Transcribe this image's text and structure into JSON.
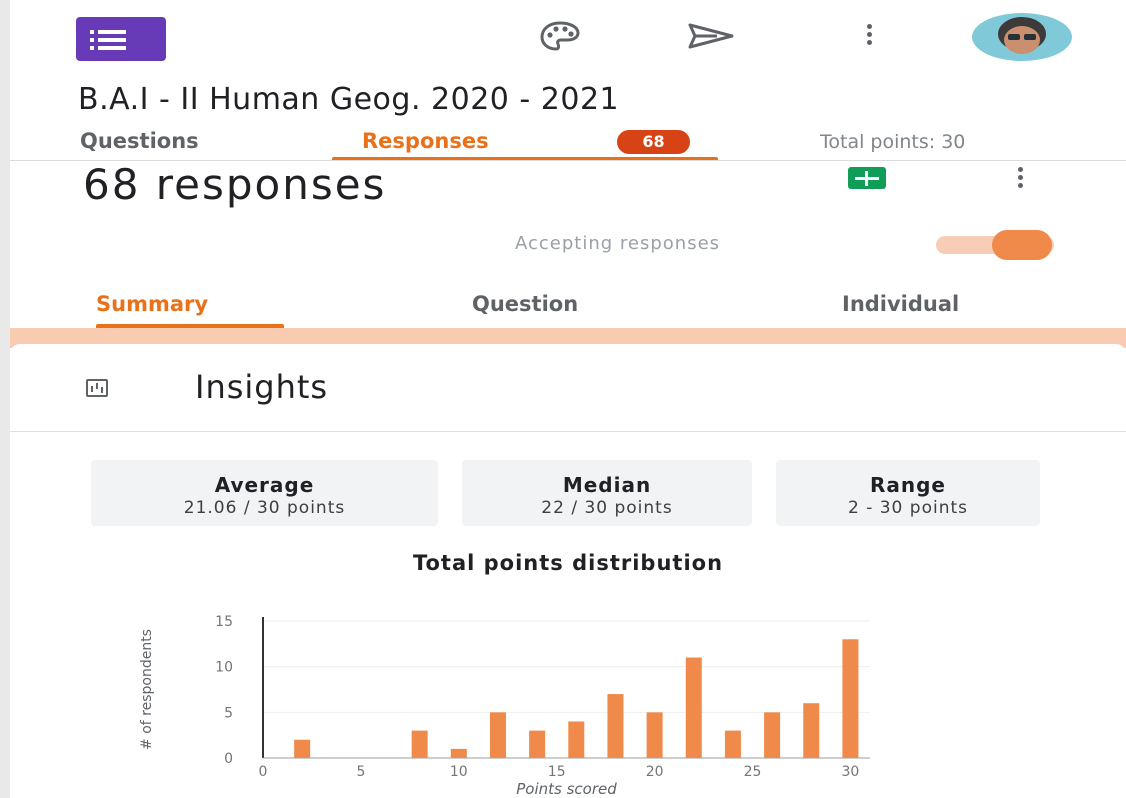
{
  "app": {
    "form_title": "B.A.I - II Human Geog. 2020 - 2021",
    "colors": {
      "accent": "#e8711a",
      "badge": "#d84315",
      "forms_purple": "#673ab7",
      "sheets_green": "#0f9d58"
    }
  },
  "topbar": {
    "icons": [
      "forms-app-icon",
      "palette-icon",
      "send-icon",
      "more-vert-icon",
      "avatar"
    ]
  },
  "tabs": {
    "questions_label": "Questions",
    "responses_label": "Responses",
    "responses_badge": "68",
    "total_points": "Total points: 30"
  },
  "responses_header": {
    "count_text": "68 responses",
    "accepting_label": "Accepting responses",
    "accepting_on": true
  },
  "subtabs": {
    "summary": "Summary",
    "question": "Question",
    "individual": "Individual"
  },
  "insights": {
    "title": "Insights",
    "average_label": "Average",
    "average_value": "21.06 / 30 points",
    "median_label": "Median",
    "median_value": "22 / 30 points",
    "range_label": "Range",
    "range_value": "2 - 30 points"
  },
  "chart_data": {
    "type": "bar",
    "title": "Total points distribution",
    "xlabel": "Points scored",
    "ylabel": "# of respondents",
    "x": [
      2,
      8,
      10,
      12,
      14,
      16,
      18,
      20,
      22,
      24,
      26,
      28,
      30
    ],
    "values": [
      2,
      3,
      1,
      5,
      3,
      4,
      7,
      5,
      11,
      3,
      5,
      6,
      13
    ],
    "xlim": [
      0,
      31
    ],
    "ylim": [
      0,
      15
    ],
    "xticks": [
      0,
      5,
      10,
      15,
      20,
      25,
      30
    ],
    "yticks": [
      0,
      5,
      10,
      15
    ],
    "grid": true,
    "color": "#f08a4b"
  }
}
